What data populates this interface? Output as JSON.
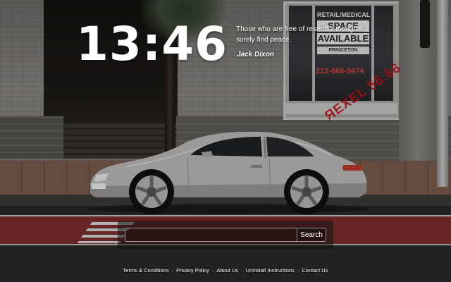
{
  "clock": {
    "time": "13:46"
  },
  "quote": {
    "text": "Those who are free of resentful thoughts surely find peace.",
    "author": "Jack Dixon"
  },
  "search": {
    "value": "",
    "placeholder": "",
    "button_label": "Search"
  },
  "footer": {
    "links": [
      {
        "label": "Terms & Conditions"
      },
      {
        "label": "Privacy Policy"
      },
      {
        "label": "About Us"
      },
      {
        "label": "Uninstall Instructions"
      },
      {
        "label": "Contact Us"
      }
    ],
    "separator": "·"
  },
  "background": {
    "storefront_sign": {
      "line1": "RETAIL/MEDICAL",
      "line2": "SPACE",
      "line3": "AVAILABLE",
      "brand": "PRINCETON",
      "phone": "212-666-9474"
    },
    "watermark": "ЯEXEL 56.66"
  }
}
